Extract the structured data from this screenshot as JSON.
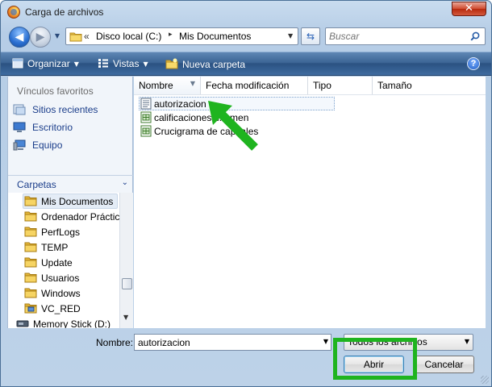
{
  "window": {
    "title": "Carga de archivos",
    "close_label": "✕"
  },
  "address": {
    "overflow": "«",
    "segments": [
      "Disco local (C:)",
      "Mis Documentos"
    ],
    "separator": "▸"
  },
  "search": {
    "placeholder": "Buscar"
  },
  "toolbar": {
    "organize": "Organizar",
    "views": "Vistas",
    "new_folder": "Nueva carpeta",
    "help": "?"
  },
  "sidebar": {
    "favorites_header": "Vínculos favoritos",
    "favorites": [
      {
        "label": "Sitios recientes",
        "icon": "recent-places-icon"
      },
      {
        "label": "Escritorio",
        "icon": "desktop-icon"
      },
      {
        "label": "Equipo",
        "icon": "computer-icon"
      }
    ],
    "folders_header": "Carpetas",
    "folders": [
      {
        "label": "Mis Documentos",
        "icon": "folder-icon",
        "selected": true
      },
      {
        "label": "Ordenador Práctic",
        "icon": "folder-icon"
      },
      {
        "label": "PerfLogs",
        "icon": "folder-icon"
      },
      {
        "label": "TEMP",
        "icon": "folder-icon"
      },
      {
        "label": "Update",
        "icon": "folder-icon"
      },
      {
        "label": "Usuarios",
        "icon": "folder-icon"
      },
      {
        "label": "Windows",
        "icon": "folder-icon"
      },
      {
        "label": "VC_RED",
        "icon": "folder-special-icon"
      },
      {
        "label": "Memory Stick (D:)",
        "icon": "drive-icon"
      }
    ]
  },
  "file_list": {
    "columns": [
      "Nombre",
      "Fecha modificación",
      "Tipo",
      "Tamaño"
    ],
    "files": [
      {
        "name": "autorizacion",
        "icon": "text-document-icon",
        "selected": true
      },
      {
        "name": "calificaciones examen",
        "icon": "spreadsheet-document-icon"
      },
      {
        "name": "Crucigrama de capitales",
        "icon": "spreadsheet-document-icon"
      }
    ]
  },
  "footer": {
    "name_label": "Nombre:",
    "name_value": "autorizacion",
    "file_type": "Todos los archivos",
    "open_button": "Abrir",
    "cancel_button": "Cancelar"
  },
  "colors": {
    "annotation": "#1fb41f",
    "toolbar": "#3c6595",
    "link": "#1a3d8a"
  }
}
